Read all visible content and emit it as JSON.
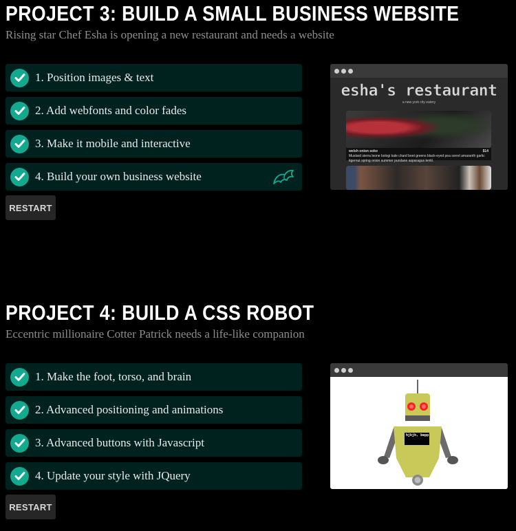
{
  "projects": [
    {
      "title": "PROJECT 3: BUILD A SMALL BUSINESS WEBSITE",
      "subtitle": "Rising star Chef Esha is opening a new restaurant and needs a website",
      "steps": [
        {
          "label": "1. Position images & text"
        },
        {
          "label": "2. Add webfonts and color fades"
        },
        {
          "label": "3. Make it mobile and interactive"
        },
        {
          "label": "4. Build your own business website"
        }
      ],
      "restart_label": "RESTART",
      "preview": {
        "restaurant_name": "esha's restaurant",
        "tagline": "a new york city eatery",
        "dish_name": "welsh onion soko",
        "dish_price": "$14",
        "dish_description": "Mustard sierra leone bologi kale chard beet greens black-eyed pea sorrel amaranth garlic tigernut spring onion summer purslane asparagus lentil."
      }
    },
    {
      "title": "PROJECT 4: BUILD A CSS ROBOT",
      "subtitle": "Eccentric millionaire Cotter Patrick needs a life-like companion",
      "steps": [
        {
          "label": "1. Make the foot, torso, and brain"
        },
        {
          "label": "2. Advanced positioning and animations"
        },
        {
          "label": "3. Advanced buttons with Javascript"
        },
        {
          "label": "4. Update your style with JQuery"
        }
      ],
      "restart_label": "RESTART",
      "preview": {
        "robot_screen_text": "hjkjh, bepp"
      }
    }
  ],
  "colors": {
    "background": "#000000",
    "step_bg": "#00221f",
    "check_green": "#12a98f",
    "subtitle_gray": "#8d8d8d",
    "robot_yellow": "#c9c95a",
    "robot_arm_gray": "#6b6b6b",
    "robot_eye_red": "#ff2020"
  },
  "icons": {
    "step_complete": "check-circle-icon",
    "project_badge": "dragon-icon",
    "browser_controls": "window-dots-icon"
  }
}
